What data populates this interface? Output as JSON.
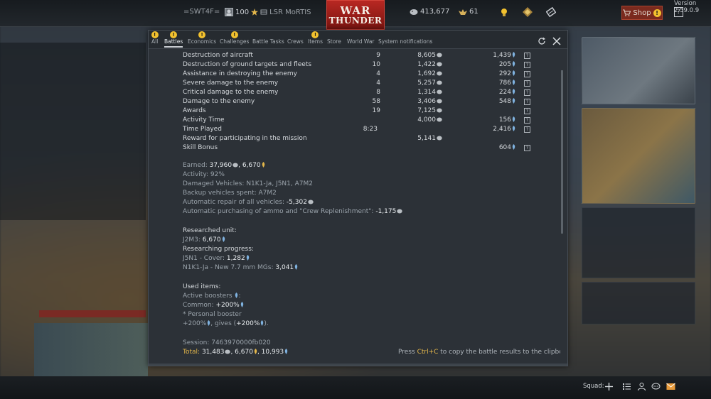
{
  "topbar": {
    "player_name": "=SWT4F=",
    "rank": "100",
    "squadron": "LSR MoRTIS",
    "logo_line1": "WAR",
    "logo_line2": "THUNDER",
    "silver": "413,677",
    "gold": "61",
    "shop_label": "Shop",
    "help_label": "?",
    "version": "Version 2.59.0.9"
  },
  "tabs": [
    {
      "label": "All",
      "warning": true
    },
    {
      "label": "Battles",
      "warning": true,
      "active": true
    },
    {
      "label": "Economics",
      "warning": true
    },
    {
      "label": "Challenges",
      "warning": true
    },
    {
      "label": "Battle Tasks",
      "warning": false
    },
    {
      "label": "Crews",
      "warning": false
    },
    {
      "label": "Items",
      "warning": true
    },
    {
      "label": "Store",
      "warning": false
    },
    {
      "label": "World War",
      "warning": false
    },
    {
      "label": "System notifications",
      "warning": false
    }
  ],
  "results": [
    {
      "label": "Destruction of aircraft",
      "count": "9",
      "silver": "8,605",
      "rp": "1,439",
      "help": true
    },
    {
      "label": "Destruction of ground targets and fleets",
      "count": "10",
      "silver": "1,422",
      "rp": "205",
      "help": true
    },
    {
      "label": "Assistance in destroying the enemy",
      "count": "4",
      "silver": "1,692",
      "rp": "292",
      "help": true
    },
    {
      "label": "Severe damage to the enemy",
      "count": "4",
      "silver": "5,257",
      "rp": "786",
      "help": true
    },
    {
      "label": "Critical damage to the enemy",
      "count": "8",
      "silver": "1,314",
      "rp": "224",
      "help": true
    },
    {
      "label": "Damage to the enemy",
      "count": "58",
      "silver": "3,406",
      "rp": "548",
      "help": true
    },
    {
      "label": "Awards",
      "count": "19",
      "silver": "7,125",
      "rp": "",
      "help": true
    },
    {
      "label": "Activity Time",
      "count": "",
      "silver": "4,000",
      "rp": "156",
      "help": true
    },
    {
      "label": "Time Played",
      "count": "8:23",
      "silver": "",
      "rp": "2,416",
      "help": true
    },
    {
      "label": "Reward for participating in the mission",
      "count": "",
      "silver": "5,141",
      "rp": "",
      "help": false
    },
    {
      "label": "Skill Bonus",
      "count": "",
      "silver": "",
      "rp": "604",
      "help": true
    }
  ],
  "summary": {
    "earned_label": "Earned:",
    "earned_silver": "37,960",
    "earned_rp": "6,670",
    "activity": "Activity: 92%",
    "damaged": "Damaged Vehicles: N1K1-Ja, J5N1, A7M2",
    "backup": "Backup vehicles spent: A7M2",
    "repair_label": "Automatic repair of all vehicles:",
    "repair_value": "-5,302",
    "ammo_label": "Automatic purchasing of ammo and \"Crew Replenishment\":",
    "ammo_value": "-1,175",
    "researched_header": "Researched unit:",
    "researched_unit": "J2M3:",
    "researched_rp": "6,670",
    "progress_header": "Researching progress:",
    "progress_1_label": "J5N1 - Cover:",
    "progress_1_value": "1,282",
    "progress_2_label": "N1K1-Ja - New 7.7 mm MGs:",
    "progress_2_value": "3,041",
    "used_items": "Used items:",
    "active_boosters": "Active boosters",
    "colon": ":",
    "common_label": "Common:",
    "common_value": "+200%",
    "personal_booster": "* Personal booster",
    "booster_pct": "+200%",
    "booster_gives": ", gives (",
    "booster_gives_value": "+200%",
    "booster_close": ").",
    "session": "Session: 7463970000fb020",
    "total_label": "Total:",
    "total_silver": "31,483",
    "total_rp1": "6,670",
    "total_rp2": "10,993",
    "hint_pre": "Press ",
    "hint_key": "Ctrl+C",
    "hint_post": " to copy the battle results to the clipboard"
  },
  "bottombar": {
    "squad_label": "Squad:"
  },
  "colors": {
    "accent_gold": "#e3b64b",
    "rp_blue": "#7fb2e0",
    "silver": "#b9bec3",
    "warn_yellow": "#f2c12e",
    "logo_red": "#b82822"
  }
}
